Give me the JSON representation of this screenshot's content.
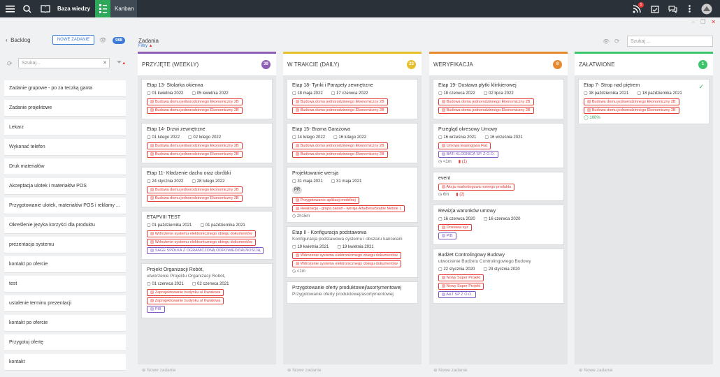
{
  "topbar": {
    "brand": "Baza wiedzy",
    "kanban": "Kanban",
    "notif_count": "5"
  },
  "sidebar": {
    "back": "Backlog",
    "new_task": "NOWE ZADANIE",
    "count": "988",
    "search": "Szukaj...",
    "items": [
      "Zadanie grupowe - po za teczką ganta",
      "Zadanie projektowe",
      "Lekarz",
      "Wykonać telefon",
      "Druk materiałów",
      "Akceptacja ulotek i materiałów POS",
      "Przygotowanie ulotek, materiałów POS i reklamy ...",
      "Określenie języka korzyści dla produktu",
      "prezentacja systemu",
      "kontakt po ofercie",
      "test",
      "ustalenie terminu prezentacji",
      "kontakt po ofercie",
      "Przygotuj ofertę",
      "kontakt"
    ]
  },
  "main": {
    "title": "Zadania",
    "filters": "Filtry",
    "search": "Szukaj ...",
    "add": "Nowe zadanie"
  },
  "colors": {
    "c1": "#8e5fb5",
    "c2": "#e6c02d",
    "c3": "#e58a2e",
    "c4": "#3ec46b"
  },
  "columns": [
    {
      "name": "PRZYJĘTE (WEEKLY)",
      "count": "39",
      "cards": [
        {
          "title": "Etap 13- Stolarka okienna",
          "d1": "01 kwietnia 2022",
          "d2": "05 kwietnia 2022",
          "tags": [
            "Budowa domu jednorodzinnego Ekonomiczny 2B",
            "Budowa domu jednorodzinnego Ekonomiczny 2B"
          ]
        },
        {
          "title": "Etap 14- Drzwi zewnętrzne",
          "d1": "01 lutego 2022",
          "d2": "02 lutego 2022",
          "tags": [
            "Budowa domu jednorodzinnego Ekonomiczny 2B",
            "Budowa domu jednorodzinnego Ekonomiczny 2B"
          ]
        },
        {
          "title": "Etap 11- Kładzenie dachu oraz obróbki",
          "d1": "24 stycznia 2022",
          "d2": "28 lutego 2022",
          "tags": [
            "Budowa domu jednorodzinnego Ekonomiczny 2B",
            "Budowa domu jednorodzinnego Ekonomiczny 2B"
          ]
        },
        {
          "title": "ETAPVIII TEST",
          "d1": "01 października 2021",
          "d2": "01 października 2021",
          "tags": [
            "Wdrożenie systemu elektronicznego obiegu dokumentów",
            "Wdrożenie systemu elektronicznego obiegu dokumentów",
            "SAGE SPÓŁKA Z OGRANICZONĄ ODPOWIEDZIALNOŚCIĄ"
          ]
        },
        {
          "title": "Projekt Organizacji Robót,",
          "sub": "utworzenie Projektu Organizacji Robót,",
          "d1": "01 czerwca 2021",
          "d2": "02 czerwca 2021",
          "tags": [
            "Zaprojektowanie budynku ul Kwiatowa",
            "Zaprojektowanie budynku ul Kwiatowa",
            "PIB"
          ]
        }
      ]
    },
    {
      "name": "W TRAKCIE (DAILY)",
      "count": "23",
      "cards": [
        {
          "title": "Etap 18- Tynki i Parapety zewnętrzne",
          "d1": "18 maja 2022",
          "d2": "17 czerwca 2022",
          "tags": [
            "Budowa domu jednorodzinnego Ekonomiczny 2B",
            "Budowa domu jednorodzinnego Ekonomiczny 2B"
          ]
        },
        {
          "title": "Etap 15- Brama Garażowa",
          "d1": "14 lutego 2022",
          "d2": "16 lutego 2022",
          "tags": [
            "Budowa domu jednorodzinnego Ekonomiczny 2B",
            "Budowa domu jednorodzinnego Ekonomiczny 2B"
          ]
        },
        {
          "title": "Projektowanie wersja",
          "d1": "31 maja 2021",
          "d2": "31 maja 2021",
          "pr": "PR",
          "tags": [
            "Przygotowanie aplikacji mobilnej",
            "Realizacja - grupa zadań - wersja Alfa/Beta/Stable Mobile 1"
          ],
          "meta": "2h15m"
        },
        {
          "title": "Etap II - Konfiguracja podstawowa",
          "sub": "Konfiguracja podstawowa systemu i obszaru kancelarii",
          "d1": "19 kwietnia 2021",
          "d2": "19 kwietnia 2021",
          "tags": [
            "Wdrożenie systemu elektronicznego obiegu dokumentów",
            "Wdrożenie systemu elektronicznego obiegu dokumentów"
          ],
          "meta": "<1m"
        },
        {
          "title": "Przygotowanie oferty produktowej/asortymentowej",
          "sub": "Przygotowanie oferty produktowej/asortymentowej",
          "d1": "",
          "d2": "",
          "tags": []
        }
      ]
    },
    {
      "name": "WERYFIKACJA",
      "count": "8",
      "cards": [
        {
          "title": "Etap 19- Dostawa płytki klinkierowej",
          "d1": "18 czerwca 2022",
          "d2": "02 lipca 2022",
          "tags": [
            "Budowa domu jednorodzinnego Ekonomiczny 2B",
            "Budowa domu jednorodzinnego Ekonomiczny 2B"
          ]
        },
        {
          "title": "Przegląd okresowy Umowy",
          "d1": "16 września 2021",
          "d2": "16 września 2021",
          "tags": [
            "Umowa leasingowa Fiat",
            "BATI KLODNICA SP. Z O.O."
          ],
          "meta": "<1m",
          "cm": "(1)"
        },
        {
          "title": "event",
          "d1": "",
          "d2": "",
          "tags": [
            "Akcja marketingowa nowego produktu"
          ],
          "meta": "6m",
          "cm": "(2)"
        },
        {
          "title": "Rewizja warunków umowy",
          "d1": "16 czerwca 2020",
          "d2": "16 czerwca 2020",
          "tags": [
            "Dostawa xyz",
            "PIB"
          ]
        },
        {
          "title": "Budżet Controlingowy Budowy",
          "sub": "utworzenie Budżetu Controlingowego Budowy",
          "d1": "22 stycznia 2020",
          "d2": "23 stycznia 2020",
          "tags": [
            "Nowy Super Projekt",
            "Nowy Super Projekt",
            "A&T SP Z O.O."
          ]
        }
      ]
    },
    {
      "name": "ZAŁATWIONE",
      "count": "1",
      "cards": [
        {
          "title": "Etap 7- Strop nad piętrem",
          "d1": "18 października 2021",
          "d2": "18 października 2021",
          "tags": [
            "Budowa domu jednorodzinnego Ekonomiczny 2B",
            "Budowa domu jednorodzinnego Ekonomiczny 2B"
          ],
          "pct": "100%"
        }
      ]
    }
  ]
}
